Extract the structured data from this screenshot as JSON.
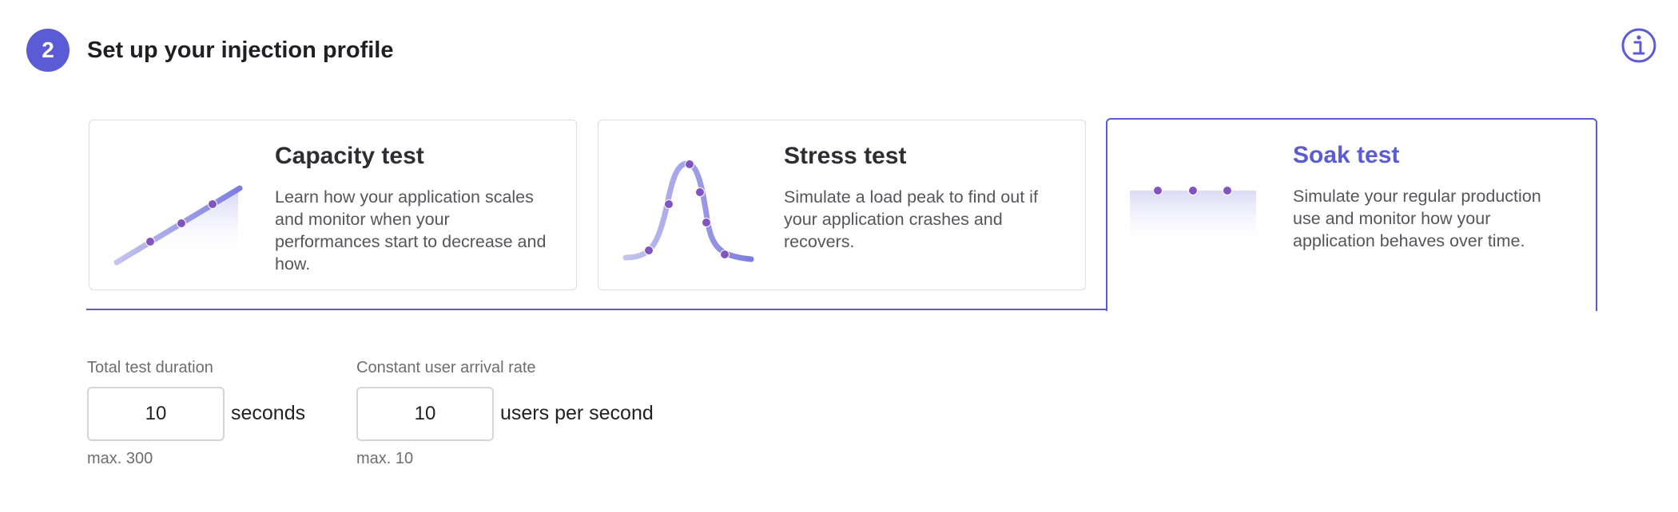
{
  "header": {
    "step_number": "2",
    "title": "Set up your injection profile"
  },
  "profiles": [
    {
      "id": "capacity",
      "title": "Capacity test",
      "description": "Learn how your application scales and monitor when your performances start to decrease and how.",
      "selected": false
    },
    {
      "id": "stress",
      "title": "Stress test",
      "description": "Simulate a load peak to find out if your application crashes and recovers.",
      "selected": false
    },
    {
      "id": "soak",
      "title": "Soak test",
      "description": "Simulate your regular production use and monitor how your application behaves over time.",
      "selected": true
    }
  ],
  "duration": {
    "label": "Total test duration",
    "value": "10",
    "unit": "seconds",
    "hint": "max. 300"
  },
  "arrival_rate": {
    "label": "Constant user arrival rate",
    "value": "10",
    "unit": "users per second",
    "hint": "max. 10"
  },
  "colors": {
    "accent": "#5b5bd6",
    "border": "#dcdce3"
  },
  "icons": {
    "info": "info-circle-icon"
  }
}
